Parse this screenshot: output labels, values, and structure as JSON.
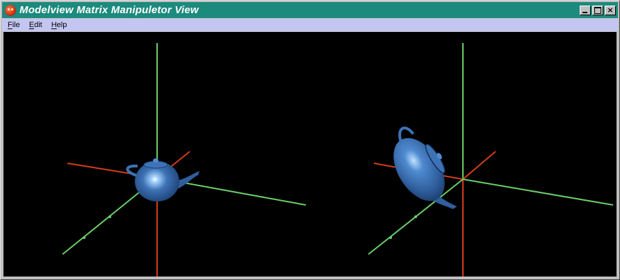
{
  "window": {
    "title": "Modelview Matrix Manipuletor View",
    "controls": {
      "minimize_icon": "minimize-icon",
      "maximize_icon": "maximize-icon",
      "close_label": "×"
    }
  },
  "menubar": {
    "items": [
      {
        "label": "File"
      },
      {
        "label": "Edit"
      },
      {
        "label": "Help"
      }
    ]
  },
  "scene": {
    "background": "#000000",
    "axis_colors": {
      "x": "#d83c1a",
      "y": "#6ccf6a",
      "z": "#6ccf6a"
    },
    "teapot_color": "#3d73b6",
    "views": [
      {
        "name": "left-view",
        "object": "teapot"
      },
      {
        "name": "right-view",
        "object": "rotated-teapot"
      }
    ]
  }
}
